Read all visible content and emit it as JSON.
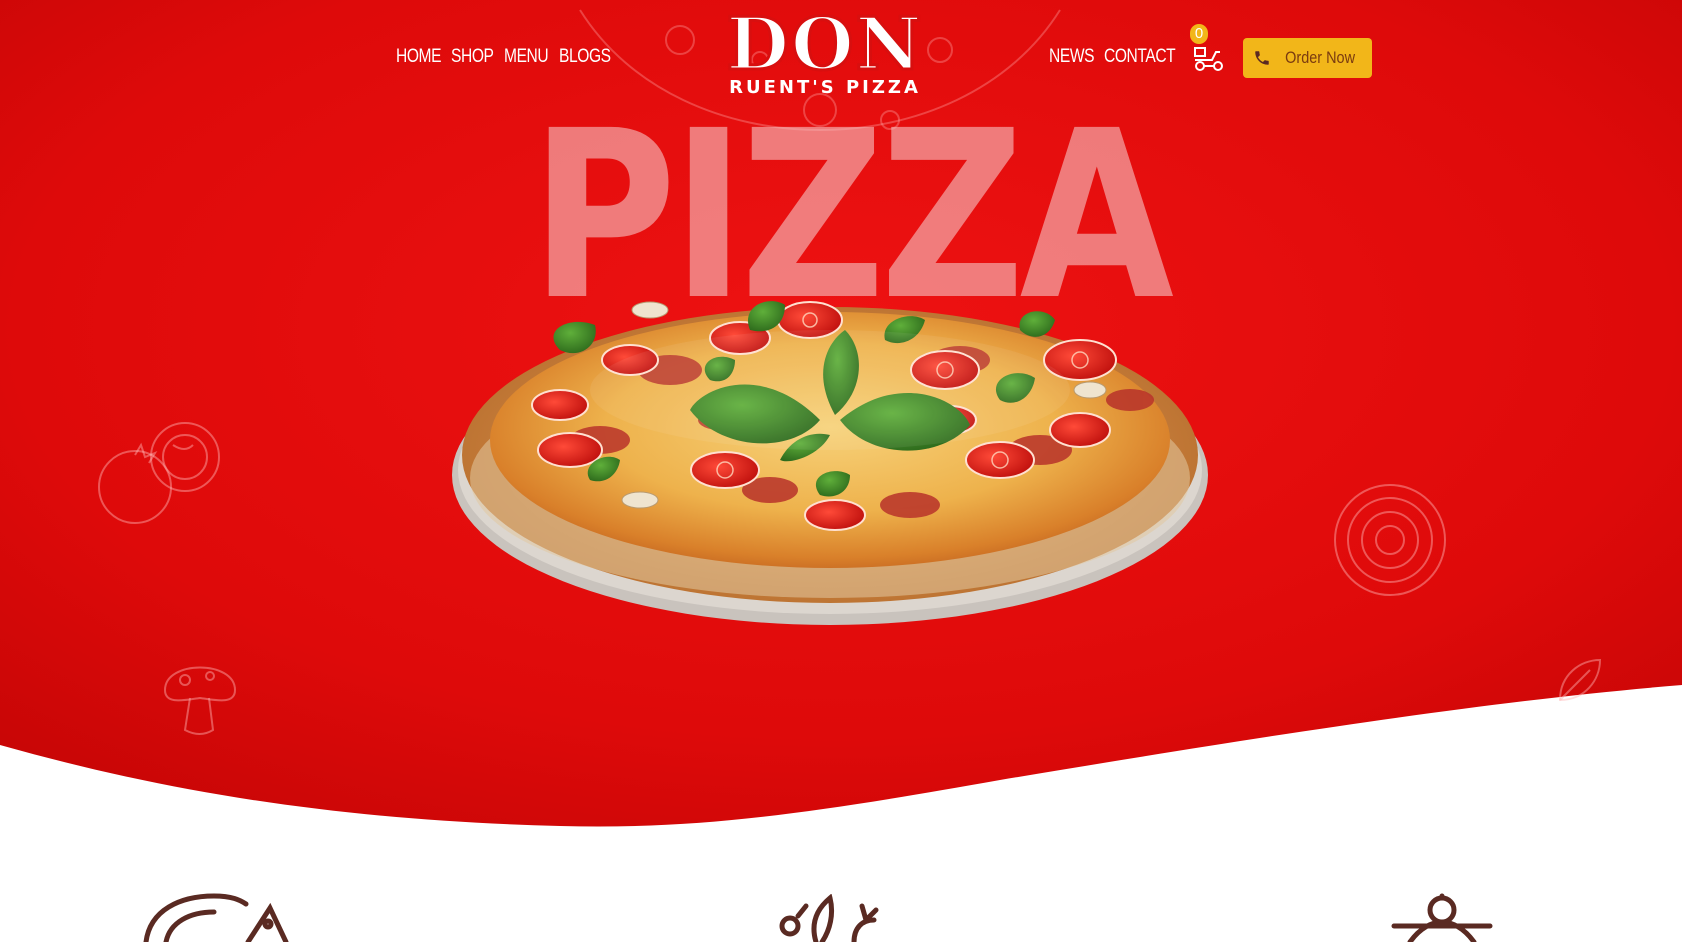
{
  "nav": {
    "left_links": [
      "HOME",
      "SHOP",
      "MENU",
      "BLOGS"
    ],
    "right_links": [
      "NEWS",
      "CONTACT"
    ]
  },
  "logo": {
    "main": "DON",
    "sub": "RUENT'S PIZZA"
  },
  "cart": {
    "count": "0",
    "icon": "delivery-scooter-icon"
  },
  "order_button": {
    "label": "Order Now",
    "icon": "phone-icon"
  },
  "hero": {
    "heading": "PIZZA"
  },
  "features": {
    "icons": [
      "pizza-slice-icon",
      "vegetables-icon",
      "chef-hat-icon"
    ]
  },
  "colors": {
    "hero_red": "#e00a0a",
    "accent_yellow": "#f2b619",
    "icon_brown": "#5a2a22",
    "white": "#ffffff"
  }
}
